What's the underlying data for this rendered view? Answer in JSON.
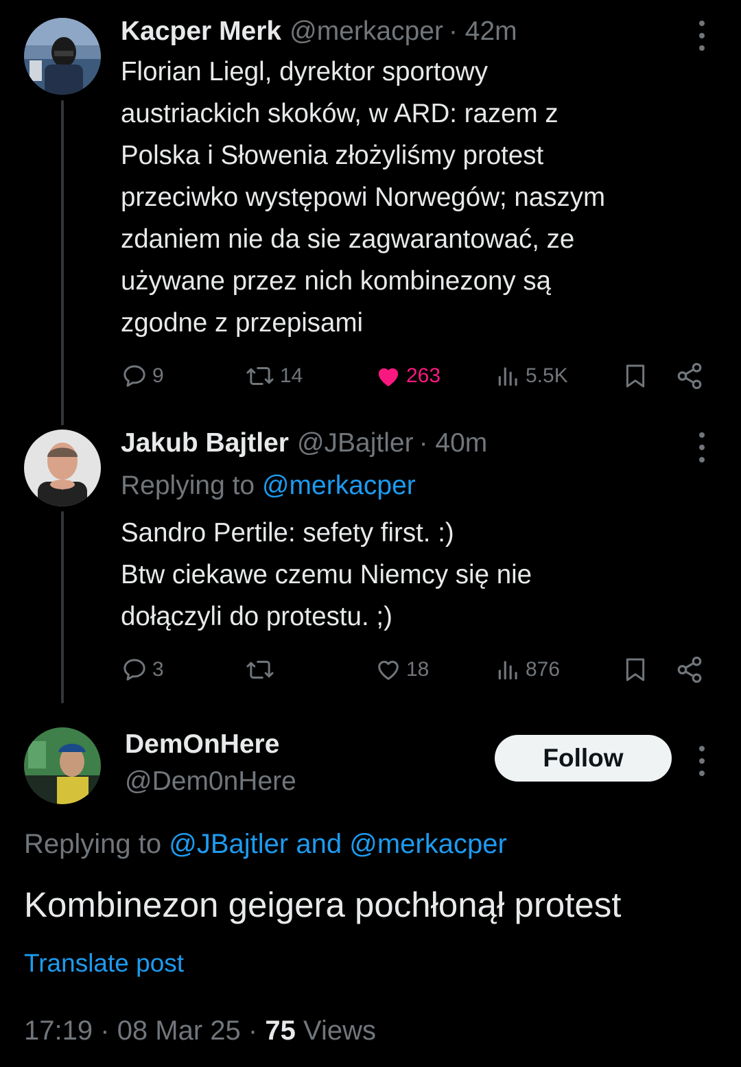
{
  "tweets": [
    {
      "author_name": "Kacper Merk",
      "handle": "@merkacper",
      "time": "· 42m",
      "lines": [
        "Florian Liegl, dyrektor sportowy",
        "austriackich skoków, w ARD: razem z",
        "Polska i Słowenia złożyliśmy protest",
        "przeciwko występowi Norwegów; naszym",
        "zdaniem nie da sie zagwarantować, ze",
        "używane przez nich kombinezony są",
        "zgodne z przepisami"
      ],
      "replies": "9",
      "reposts": "14",
      "likes": "263",
      "views": "5.5K",
      "liked": true
    },
    {
      "author_name": "Jakub Bajtler",
      "handle": "@JBajtler",
      "time": "· 40m",
      "replying_prefix": "Replying to",
      "replying_to": "@merkacper",
      "lines": [
        "Sandro Pertile: sefety first. :)",
        "Btw ciekawe czemu Niemcy się nie",
        "dołączyli do protestu. ;)"
      ],
      "replies": "3",
      "reposts": "",
      "likes": "18",
      "views": "876",
      "liked": false
    }
  ],
  "main_post": {
    "author_name": "DemOnHere",
    "handle": "@Dem0nHere",
    "follow_label": "Follow",
    "replying_prefix": "Replying to",
    "replying_to_1": "@JBajtler",
    "replying_and": "and",
    "replying_to_2": "@merkacper",
    "text": "Kombinezon geigera pochłonął protest",
    "translate_label": "Translate post",
    "time": "17:19",
    "date": "08 Mar 25",
    "views_count": "75",
    "views_label": "Views",
    "separator": "·"
  },
  "colors": {
    "background": "#000000",
    "text": "#e7e9ea",
    "muted": "#71767b",
    "accent": "#1d9bf0",
    "like": "#f91880"
  }
}
